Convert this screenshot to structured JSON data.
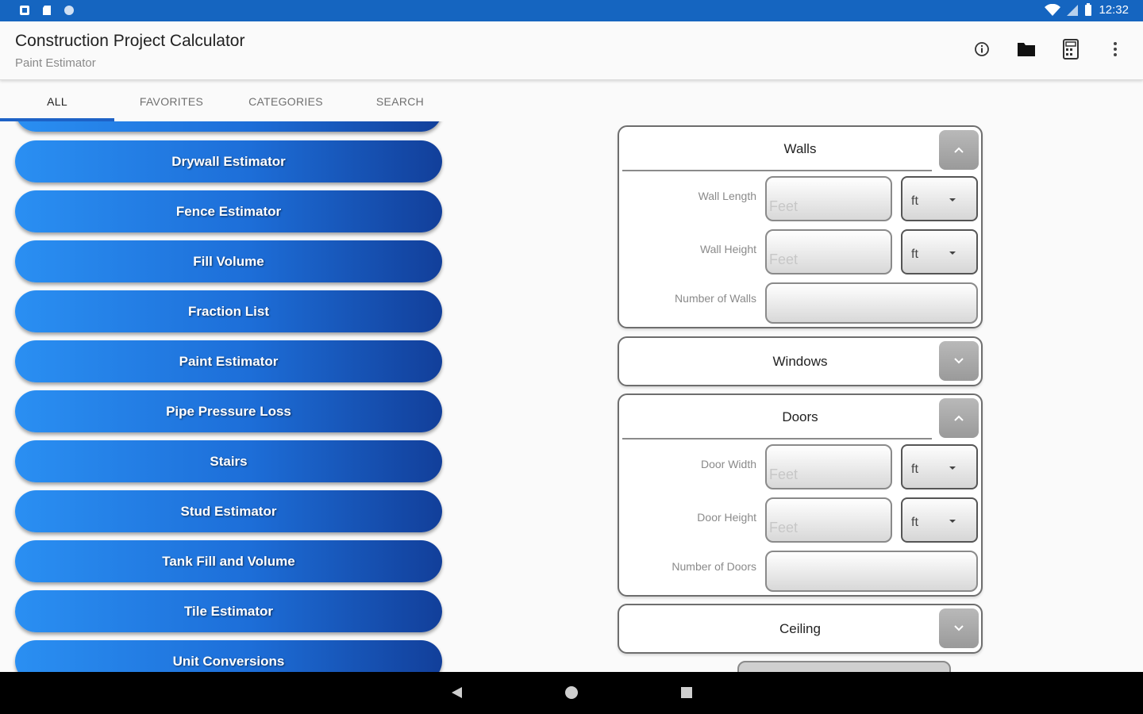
{
  "status_bar": {
    "time": "12:32"
  },
  "app_bar": {
    "title": "Construction Project Calculator",
    "subtitle": "Paint Estimator"
  },
  "tabs": [
    {
      "label": "ALL",
      "active": true
    },
    {
      "label": "FAVORITES",
      "active": false
    },
    {
      "label": "CATEGORIES",
      "active": false
    },
    {
      "label": "SEARCH",
      "active": false
    }
  ],
  "calculators": [
    "Drywall Estimator",
    "Fence Estimator",
    "Fill Volume",
    "Fraction List",
    "Paint Estimator",
    "Pipe Pressure Loss",
    "Stairs",
    "Stud Estimator",
    "Tank Fill and Volume",
    "Tile Estimator",
    "Unit Conversions"
  ],
  "sections": {
    "walls": {
      "title": "Walls",
      "expanded": true,
      "wall_length": {
        "label": "Wall Length",
        "placeholder": "Feet",
        "unit": "ft"
      },
      "wall_height": {
        "label": "Wall Height",
        "placeholder": "Feet",
        "unit": "ft"
      },
      "number_of_walls": {
        "label": "Number of Walls",
        "value": ""
      }
    },
    "windows": {
      "title": "Windows",
      "expanded": false
    },
    "doors": {
      "title": "Doors",
      "expanded": true,
      "door_width": {
        "label": "Door Width",
        "placeholder": "Feet",
        "unit": "ft"
      },
      "door_height": {
        "label": "Door Height",
        "placeholder": "Feet",
        "unit": "ft"
      },
      "number_of_doors": {
        "label": "Number of Doors",
        "value": ""
      }
    },
    "ceiling": {
      "title": "Ceiling",
      "expanded": false
    }
  },
  "colors": {
    "status_bar": "#1565c0",
    "button_light": "#2a8ff2",
    "button_dark": "#123f9a",
    "tab_indicator": "#1e62c6"
  },
  "icons": [
    "info-icon",
    "folder-icon",
    "calculator-icon",
    "more-vert-icon",
    "wifi-icon",
    "signal-icon",
    "battery-icon"
  ]
}
